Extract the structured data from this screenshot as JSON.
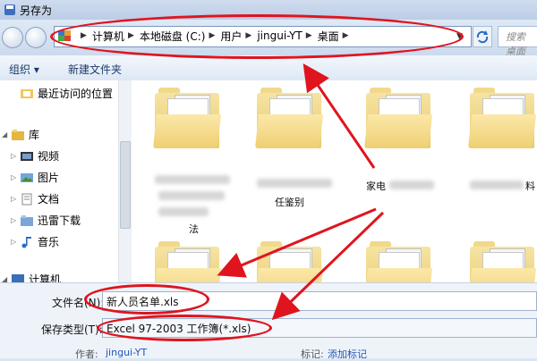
{
  "window": {
    "title": "另存为"
  },
  "address": {
    "crumbs": [
      "计算机",
      "本地磁盘 (C:)",
      "用户",
      "jingui-YT",
      "桌面"
    ],
    "search_placeholder": "搜索 桌面"
  },
  "toolbar": {
    "organize": "组织 ▾",
    "new_folder": "新建文件夹"
  },
  "sidebar": {
    "recent": "最近访问的位置",
    "library": "库",
    "items": [
      "视频",
      "图片",
      "文档",
      "迅雷下载",
      "音乐"
    ],
    "computer": "计算机"
  },
  "files": {
    "row1": [
      {
        "name": "",
        "caption2": "法"
      },
      {
        "name": "",
        "caption2": "任鉴别"
      },
      {
        "name": "家电"
      },
      {
        "name": "料"
      }
    ]
  },
  "form": {
    "filename_label": "文件名(N):",
    "filename_value": "新人员名单.xls",
    "filetype_label": "保存类型(T):",
    "filetype_value": "Excel 97-2003 工作簿(*.xls)",
    "author_label": "作者:",
    "author_value": "jingui-YT",
    "tags_label": "标记:",
    "tags_value": "添加标记"
  },
  "colors": {
    "annotation": "#e0141e",
    "link": "#1f56b5"
  }
}
